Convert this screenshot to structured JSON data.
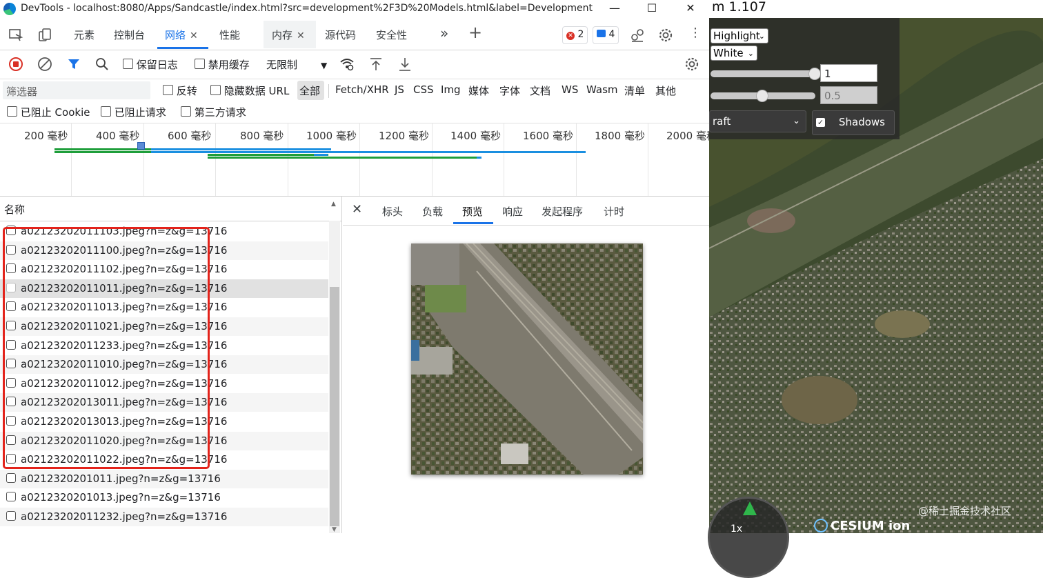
{
  "window": {
    "title": "DevTools - localhost:8080/Apps/Sandcastle/index.html?src=development%2F3D%20Models.html&label=Development",
    "minimize": "—",
    "maximize": "☐",
    "close": "✕"
  },
  "tabs": {
    "elements": "元素",
    "console": "控制台",
    "network": "网络",
    "performance": "性能",
    "memory": "内存",
    "sources": "源代码",
    "security": "安全性",
    "more": "»",
    "add": "+",
    "error_count": "2",
    "message_count": "4"
  },
  "network_toolbar": {
    "preserve_log": "保留日志",
    "disable_cache": "禁用缓存",
    "throttling": "无限制"
  },
  "filter": {
    "placeholder": "筛选器",
    "invert": "反转",
    "hide_data_urls": "隐藏数据 URL",
    "types": [
      "全部",
      "Fetch/XHR",
      "JS",
      "CSS",
      "Img",
      "媒体",
      "字体",
      "文档",
      "WS",
      "Wasm",
      "清单",
      "其他"
    ],
    "blocked_cookies": "已阻止 Cookie",
    "blocked_requests": "已阻止请求",
    "third_party": "第三方请求"
  },
  "timeline": {
    "ticks": [
      "200 毫秒",
      "400 毫秒",
      "600 毫秒",
      "800 毫秒",
      "1000 毫秒",
      "1200 毫秒",
      "1400 毫秒",
      "1600 毫秒",
      "1800 毫秒",
      "2000 毫秒"
    ]
  },
  "requests": {
    "column_name": "名称",
    "rows": [
      "a02123202011103.jpeg?n=z&g=13716",
      "a02123202011100.jpeg?n=z&g=13716",
      "a02123202011102.jpeg?n=z&g=13716",
      "a02123202011011.jpeg?n=z&g=13716",
      "a02123202011013.jpeg?n=z&g=13716",
      "a02123202011021.jpeg?n=z&g=13716",
      "a02123202011233.jpeg?n=z&g=13716",
      "a02123202011010.jpeg?n=z&g=13716",
      "a02123202011012.jpeg?n=z&g=13716",
      "a02123202013011.jpeg?n=z&g=13716",
      "a02123202013013.jpeg?n=z&g=13716",
      "a02123202011020.jpeg?n=z&g=13716",
      "a02123202011022.jpeg?n=z&g=13716",
      "a0212320201011.jpeg?n=z&g=13716",
      "a0212320201013.jpeg?n=z&g=13716",
      "a02123202011232.jpeg?n=z&g=13716"
    ]
  },
  "detail_tabs": {
    "close": "✕",
    "headers": "标头",
    "payload": "负载",
    "preview": "预览",
    "response": "响应",
    "initiator": "发起程序",
    "timing": "计时"
  },
  "sandcastle": {
    "version": "m 1.107",
    "highlight_select": "Highlight",
    "color_select": "White",
    "alpha_value": "1",
    "alpha2_value": "0.5",
    "model_select": "raft",
    "shadows_label": "Shadows",
    "zoom_label": "1x",
    "cesium_logo": "CESIUM ion",
    "watermark": "@稀土掘金技术社区"
  },
  "colors": {
    "accent": "#1a73e8",
    "highlight_border": "#e3231b",
    "record_red": "#d93025",
    "timeline_green": "#1e9e3a",
    "timeline_blue": "#1a8fe0"
  }
}
